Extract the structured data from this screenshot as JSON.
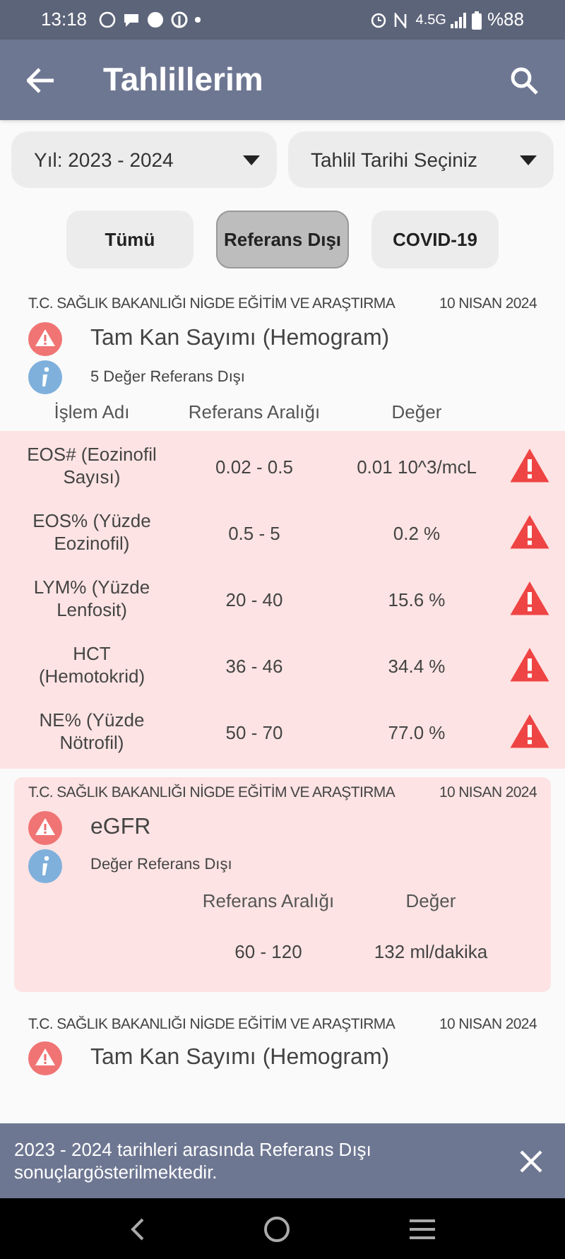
{
  "status_bar": {
    "time": "13:18",
    "network": "4.5G",
    "battery": "%88"
  },
  "app_bar": {
    "title": "Tahlillerim"
  },
  "filters": {
    "dropdowns": [
      {
        "label": "Yıl: 2023 - 2024"
      },
      {
        "label": "Tahlil Tarihi Seçiniz"
      }
    ],
    "tabs": [
      {
        "label": "Tümü",
        "selected": false
      },
      {
        "label": "Referans Dışı",
        "selected": true
      },
      {
        "label": "COVID-19",
        "selected": false
      }
    ]
  },
  "results": [
    {
      "institution": "T.C. SAĞLIK BAKANLIĞI NİGDE EĞİTİM VE ARAŞTIRMA",
      "date": "10 NISAN 2024",
      "title": "Tam Kan Sayımı (Hemogram)",
      "highlighted": false,
      "info": "5 Değer Referans Dışı",
      "columns": [
        "İşlem Adı",
        "Referans Aralığı",
        "Değer"
      ],
      "rows": [
        {
          "name": "EOS# (Eozinofil Sayısı)",
          "range": "0.02 - 0.5",
          "value": "0.01 10^3/mcL",
          "warning": true
        },
        {
          "name": "EOS% (Yüzde Eozinofil)",
          "range": "0.5 - 5",
          "value": "0.2 %",
          "warning": true
        },
        {
          "name": "LYM% (Yüzde Lenfosit)",
          "range": "20 - 40",
          "value": "15.6 %",
          "warning": true
        },
        {
          "name": "HCT (Hemotokrid)",
          "range": "36 - 46",
          "value": "34.4 %",
          "warning": true
        },
        {
          "name": "NE% (Yüzde Nötrofil)",
          "range": "50 - 70",
          "value": "77.0 %",
          "warning": true
        }
      ]
    },
    {
      "institution": "T.C. SAĞLIK BAKANLIĞI NİGDE EĞİTİM VE ARAŞTIRMA",
      "date": "10 NISAN 2024",
      "title": "eGFR",
      "highlighted": true,
      "info": "Değer Referans Dışı",
      "columns": [
        "Referans Aralığı",
        "Değer"
      ],
      "rows": [
        {
          "range": "60 - 120",
          "value": "132 ml/dakika",
          "warning": false
        }
      ]
    },
    {
      "institution": "T.C. SAĞLIK BAKANLIĞI NİGDE EĞİTİM VE ARAŞTIRMA",
      "date": "10 NISAN 2024",
      "title": "Tam Kan Sayımı (Hemogram)",
      "highlighted": false
    }
  ],
  "snackbar": {
    "message": "2023 - 2024 tarihleri arasında Referans Dışı sonuçlargösterilmektedir."
  }
}
